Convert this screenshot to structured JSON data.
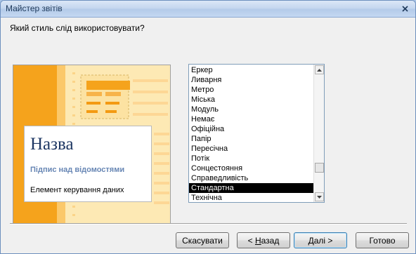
{
  "window": {
    "title": "Майстер звітів"
  },
  "question": "Який стиль слід використовувати?",
  "preview": {
    "title": "Назва",
    "subtitle": "Підпис над відомостями",
    "control": "Елемент керування даних",
    "accent_color": "#f5a31c",
    "light_color": "#fde9b4"
  },
  "styles": {
    "items": [
      "Еркер",
      "Ливарня",
      "Метро",
      "Міська",
      "Модуль",
      "Немає",
      "Офіційна",
      "Папір",
      "Пересічна",
      "Потік",
      "Сонцестояння",
      "Справедливість",
      "Стандартна",
      "Технічна"
    ],
    "selected": "Стандартна"
  },
  "buttons": {
    "cancel": "Скасувати",
    "back_prefix": "< ",
    "back_key": "Н",
    "back_rest": "азад",
    "next_key": "Д",
    "next_rest": "алі >",
    "finish": "Готово"
  }
}
